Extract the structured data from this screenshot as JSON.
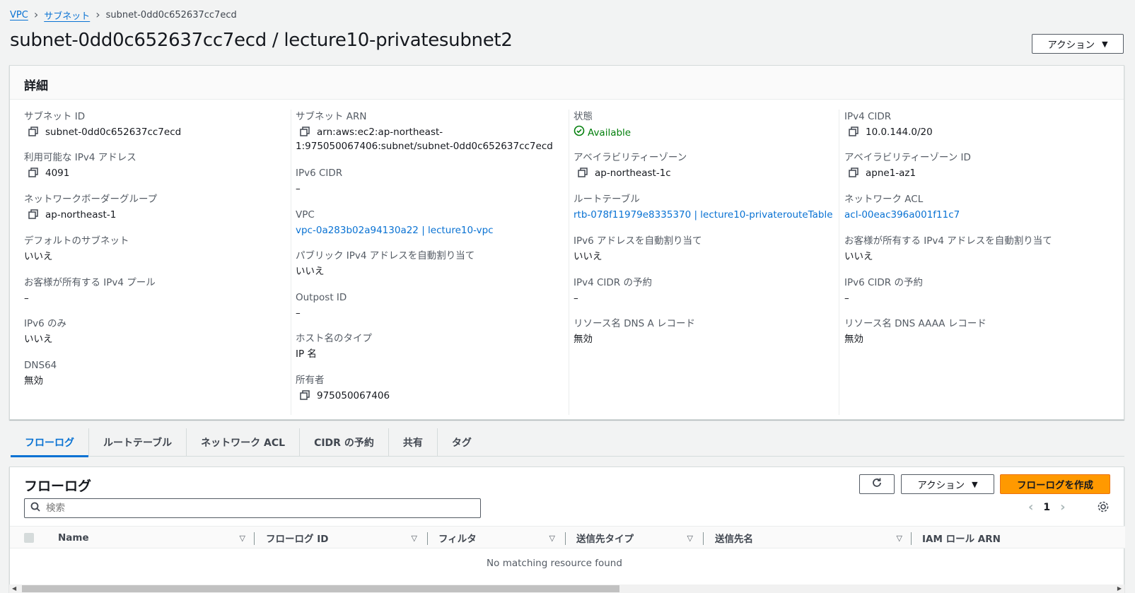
{
  "breadcrumb": {
    "root": "VPC",
    "parent": "サブネット",
    "current": "subnet-0dd0c652637cc7ecd"
  },
  "page": {
    "title": "subnet-0dd0c652637cc7ecd / lecture10-privatesubnet2",
    "actions_label": "アクション"
  },
  "details": {
    "header": "詳細",
    "col1": {
      "subnet_id": {
        "label": "サブネット ID",
        "value": "subnet-0dd0c652637cc7ecd"
      },
      "available_ipv4": {
        "label": "利用可能な IPv4 アドレス",
        "value": "4091"
      },
      "border_group": {
        "label": "ネットワークボーダーグループ",
        "value": "ap-northeast-1"
      },
      "default_subnet": {
        "label": "デフォルトのサブネット",
        "value": "いいえ"
      },
      "customer_pool": {
        "label": "お客様が所有する IPv4 プール",
        "value": "–"
      },
      "ipv6_only": {
        "label": "IPv6 のみ",
        "value": "いいえ"
      },
      "dns64": {
        "label": "DNS64",
        "value": "無効"
      }
    },
    "col2": {
      "subnet_arn": {
        "label": "サブネット ARN",
        "value_line1": "arn:aws:ec2:ap-northeast-",
        "value_line2": "1:975050067406:subnet/subnet-0dd0c652637cc7ecd"
      },
      "ipv6_cidr": {
        "label": "IPv6 CIDR",
        "value": "–"
      },
      "vpc": {
        "label": "VPC",
        "value": "vpc-0a283b02a94130a22 | lecture10-vpc"
      },
      "public_ipv4_auto": {
        "label": "パブリック IPv4 アドレスを自動割り当て",
        "value": "いいえ"
      },
      "outpost_id": {
        "label": "Outpost ID",
        "value": "–"
      },
      "hostname_type": {
        "label": "ホスト名のタイプ",
        "value": "IP 名"
      },
      "owner": {
        "label": "所有者",
        "value": "975050067406"
      }
    },
    "col3": {
      "state": {
        "label": "状態",
        "value": "Available"
      },
      "az": {
        "label": "アベイラビリティーゾーン",
        "value": "ap-northeast-1c"
      },
      "route_table": {
        "label": "ルートテーブル",
        "value": "rtb-078f11979e8335370 | lecture10-privaterouteTable"
      },
      "ipv6_auto": {
        "label": "IPv6 アドレスを自動割り当て",
        "value": "いいえ"
      },
      "ipv4_reservation": {
        "label": "IPv4 CIDR の予約",
        "value": "–"
      },
      "dns_a": {
        "label": "リソース名 DNS A レコード",
        "value": "無効"
      }
    },
    "col4": {
      "ipv4_cidr": {
        "label": "IPv4 CIDR",
        "value": "10.0.144.0/20"
      },
      "az_id": {
        "label": "アベイラビリティーゾーン ID",
        "value": "apne1-az1"
      },
      "network_acl": {
        "label": "ネットワーク ACL",
        "value": "acl-00eac396a001f11c7"
      },
      "customer_ipv4": {
        "label": "お客様が所有する IPv4 アドレスを自動割り当て",
        "value": "いいえ"
      },
      "ipv6_reservation": {
        "label": "IPv6 CIDR の予約",
        "value": "–"
      },
      "dns_aaaa": {
        "label": "リソース名 DNS AAAA レコード",
        "value": "無効"
      }
    }
  },
  "tabs": [
    "フローログ",
    "ルートテーブル",
    "ネットワーク ACL",
    "CIDR の予約",
    "共有",
    "タグ"
  ],
  "flowlog": {
    "title": "フローログ",
    "actions_label": "アクション",
    "create_label": "フローログを作成",
    "search_placeholder": "検索",
    "page_number": "1",
    "columns": [
      "Name",
      "フローログ ID",
      "フィルタ",
      "送信先タイプ",
      "送信先名",
      "IAM ロール ARN"
    ],
    "empty_message": "No matching resource found"
  },
  "colors": {
    "link": "#0972d3",
    "primary_button": "#ff9900",
    "success": "#037f0c"
  }
}
